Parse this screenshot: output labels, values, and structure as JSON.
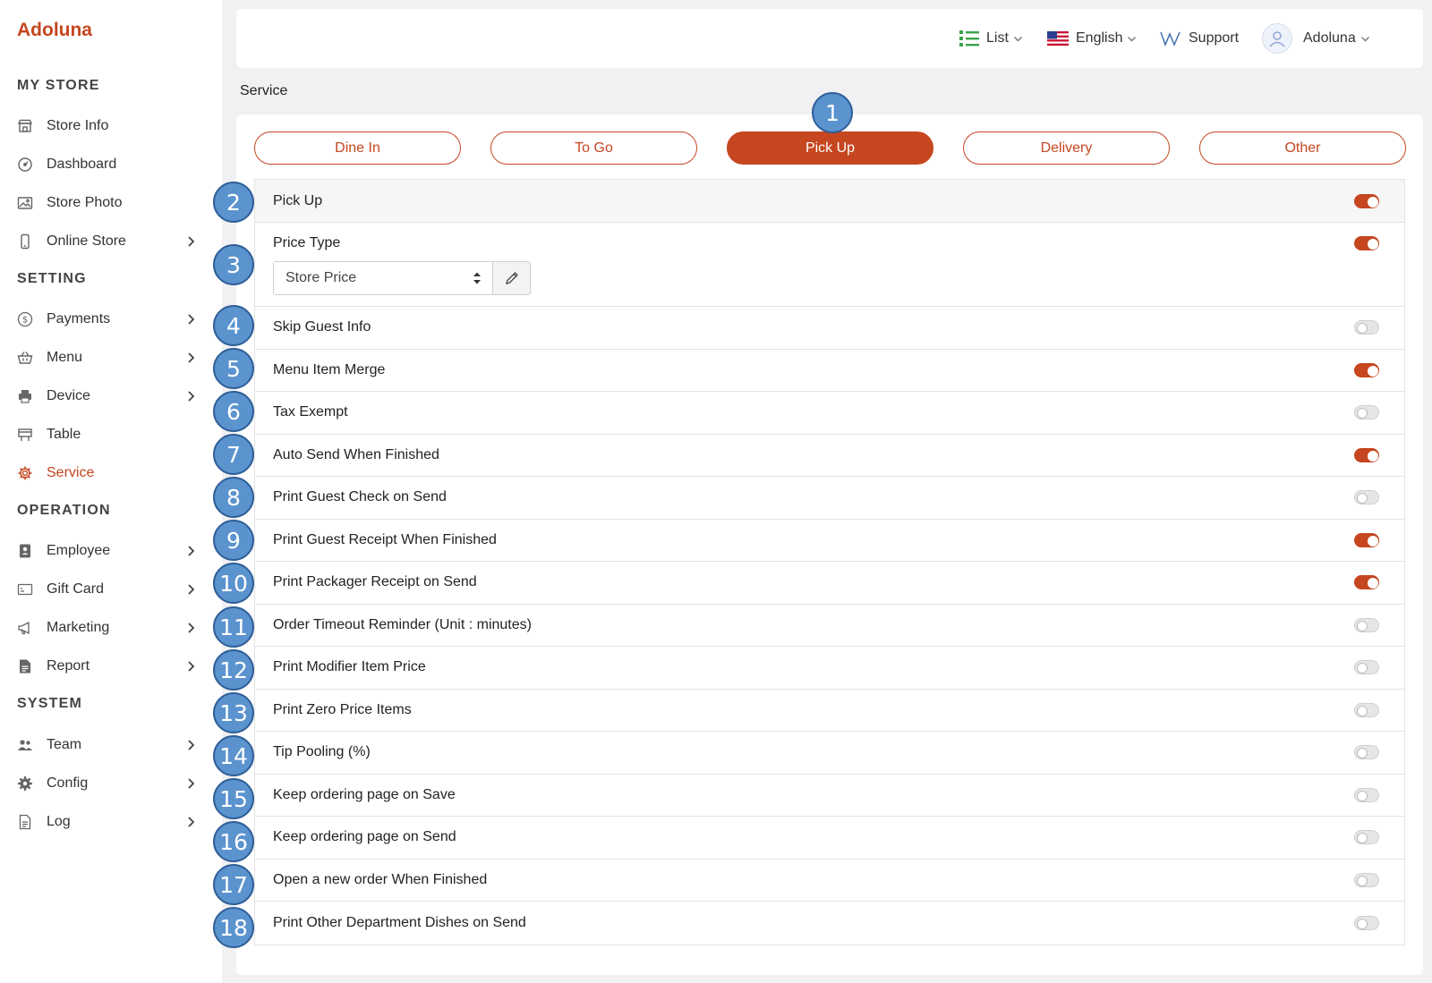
{
  "brand": "Adoluna",
  "sidebar": {
    "sections": [
      "MY STORE",
      "SETTING",
      "OPERATION",
      "SYSTEM"
    ],
    "items": [
      {
        "label": "Store Info",
        "icon": "store-icon"
      },
      {
        "label": "Dashboard",
        "icon": "dashboard-icon"
      },
      {
        "label": "Store Photo",
        "icon": "photo-icon"
      },
      {
        "label": "Online Store",
        "icon": "phone-icon"
      },
      {
        "label": "Payments",
        "icon": "dollar-icon"
      },
      {
        "label": "Menu",
        "icon": "basket-icon"
      },
      {
        "label": "Device",
        "icon": "printer-icon"
      },
      {
        "label": "Table",
        "icon": "table-icon"
      },
      {
        "label": "Service",
        "icon": "gear-icon"
      },
      {
        "label": "Employee",
        "icon": "badge-icon"
      },
      {
        "label": "Gift Card",
        "icon": "giftcard-icon"
      },
      {
        "label": "Marketing",
        "icon": "megaphone-icon"
      },
      {
        "label": "Report",
        "icon": "report-icon"
      },
      {
        "label": "Team",
        "icon": "team-icon"
      },
      {
        "label": "Config",
        "icon": "cog-icon"
      },
      {
        "label": "Log",
        "icon": "log-icon"
      }
    ]
  },
  "topbar": {
    "list_label": "List",
    "language_label": "English",
    "support_label": "Support",
    "user_label": "Adoluna"
  },
  "page": {
    "title": "Service"
  },
  "tabs": [
    {
      "label": "Dine In"
    },
    {
      "label": "To Go"
    },
    {
      "label": "Pick Up"
    },
    {
      "label": "Delivery"
    },
    {
      "label": "Other"
    }
  ],
  "settings": {
    "header_label": "Pick Up",
    "price_type_label": "Price Type",
    "price_type_value": "Store Price",
    "rows": [
      {
        "label": "Skip Guest Info",
        "on": false
      },
      {
        "label": "Menu Item Merge",
        "on": true
      },
      {
        "label": "Tax Exempt",
        "on": false
      },
      {
        "label": "Auto Send When Finished",
        "on": true
      },
      {
        "label": "Print Guest Check on Send",
        "on": false
      },
      {
        "label": "Print Guest Receipt When Finished",
        "on": true
      },
      {
        "label": "Print Packager Receipt on Send",
        "on": true
      },
      {
        "label": "Order Timeout Reminder (Unit : minutes)",
        "on": false
      },
      {
        "label": "Print Modifier Item Price",
        "on": false
      },
      {
        "label": "Print Zero Price Items",
        "on": false
      },
      {
        "label": "Tip Pooling (%)",
        "on": false
      },
      {
        "label": "Keep ordering page on Save",
        "on": false
      },
      {
        "label": "Keep ordering page on Send",
        "on": false
      },
      {
        "label": "Open a new order When Finished",
        "on": false
      },
      {
        "label": "Print Other Department Dishes on Send",
        "on": false
      }
    ]
  },
  "markers": [
    "1",
    "2",
    "3",
    "4",
    "5",
    "6",
    "7",
    "8",
    "9",
    "10",
    "11",
    "12",
    "13",
    "14",
    "15",
    "16",
    "17",
    "18"
  ],
  "colors": {
    "accent": "#c5461f",
    "marker": "#5b93cf"
  }
}
